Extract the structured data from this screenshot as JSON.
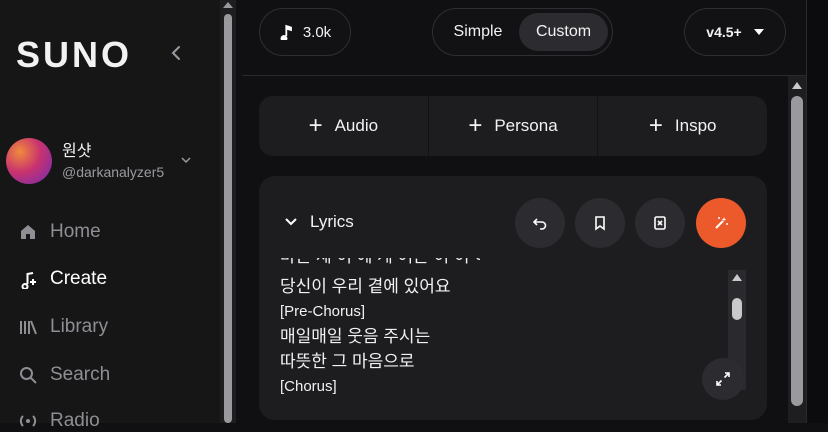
{
  "sidebar": {
    "logo": "SUNO",
    "user": {
      "name": "원샷",
      "handle": "@darkanalyzer5"
    },
    "items": [
      {
        "label": "Home",
        "icon": "home-icon",
        "active": false
      },
      {
        "label": "Create",
        "icon": "create-icon",
        "active": true
      },
      {
        "label": "Library",
        "icon": "library-icon",
        "active": false
      },
      {
        "label": "Search",
        "icon": "search-icon",
        "active": false
      },
      {
        "label": "Radio",
        "icon": "radio-icon",
        "active": false
      }
    ]
  },
  "header": {
    "credits": "3.0k",
    "mode": {
      "simple": "Simple",
      "custom": "Custom",
      "selected": "Custom"
    },
    "version": "v4.5+"
  },
  "add": {
    "audio": "Audio",
    "persona": "Persona",
    "inspo": "Inspo"
  },
  "lyrics": {
    "title": "Lyrics",
    "partial_line": "마른 세 이 에 게 어는 이 이 이 이",
    "lines": [
      "당신이 우리 곁에 있어요",
      "[Pre-Chorus]",
      "매일매일 웃음 주시는",
      "따뜻한 그 마음으로",
      "[Chorus]"
    ]
  },
  "colors": {
    "accent": "#ec5a2c",
    "background": "#101012",
    "card": "#1d1d20"
  }
}
